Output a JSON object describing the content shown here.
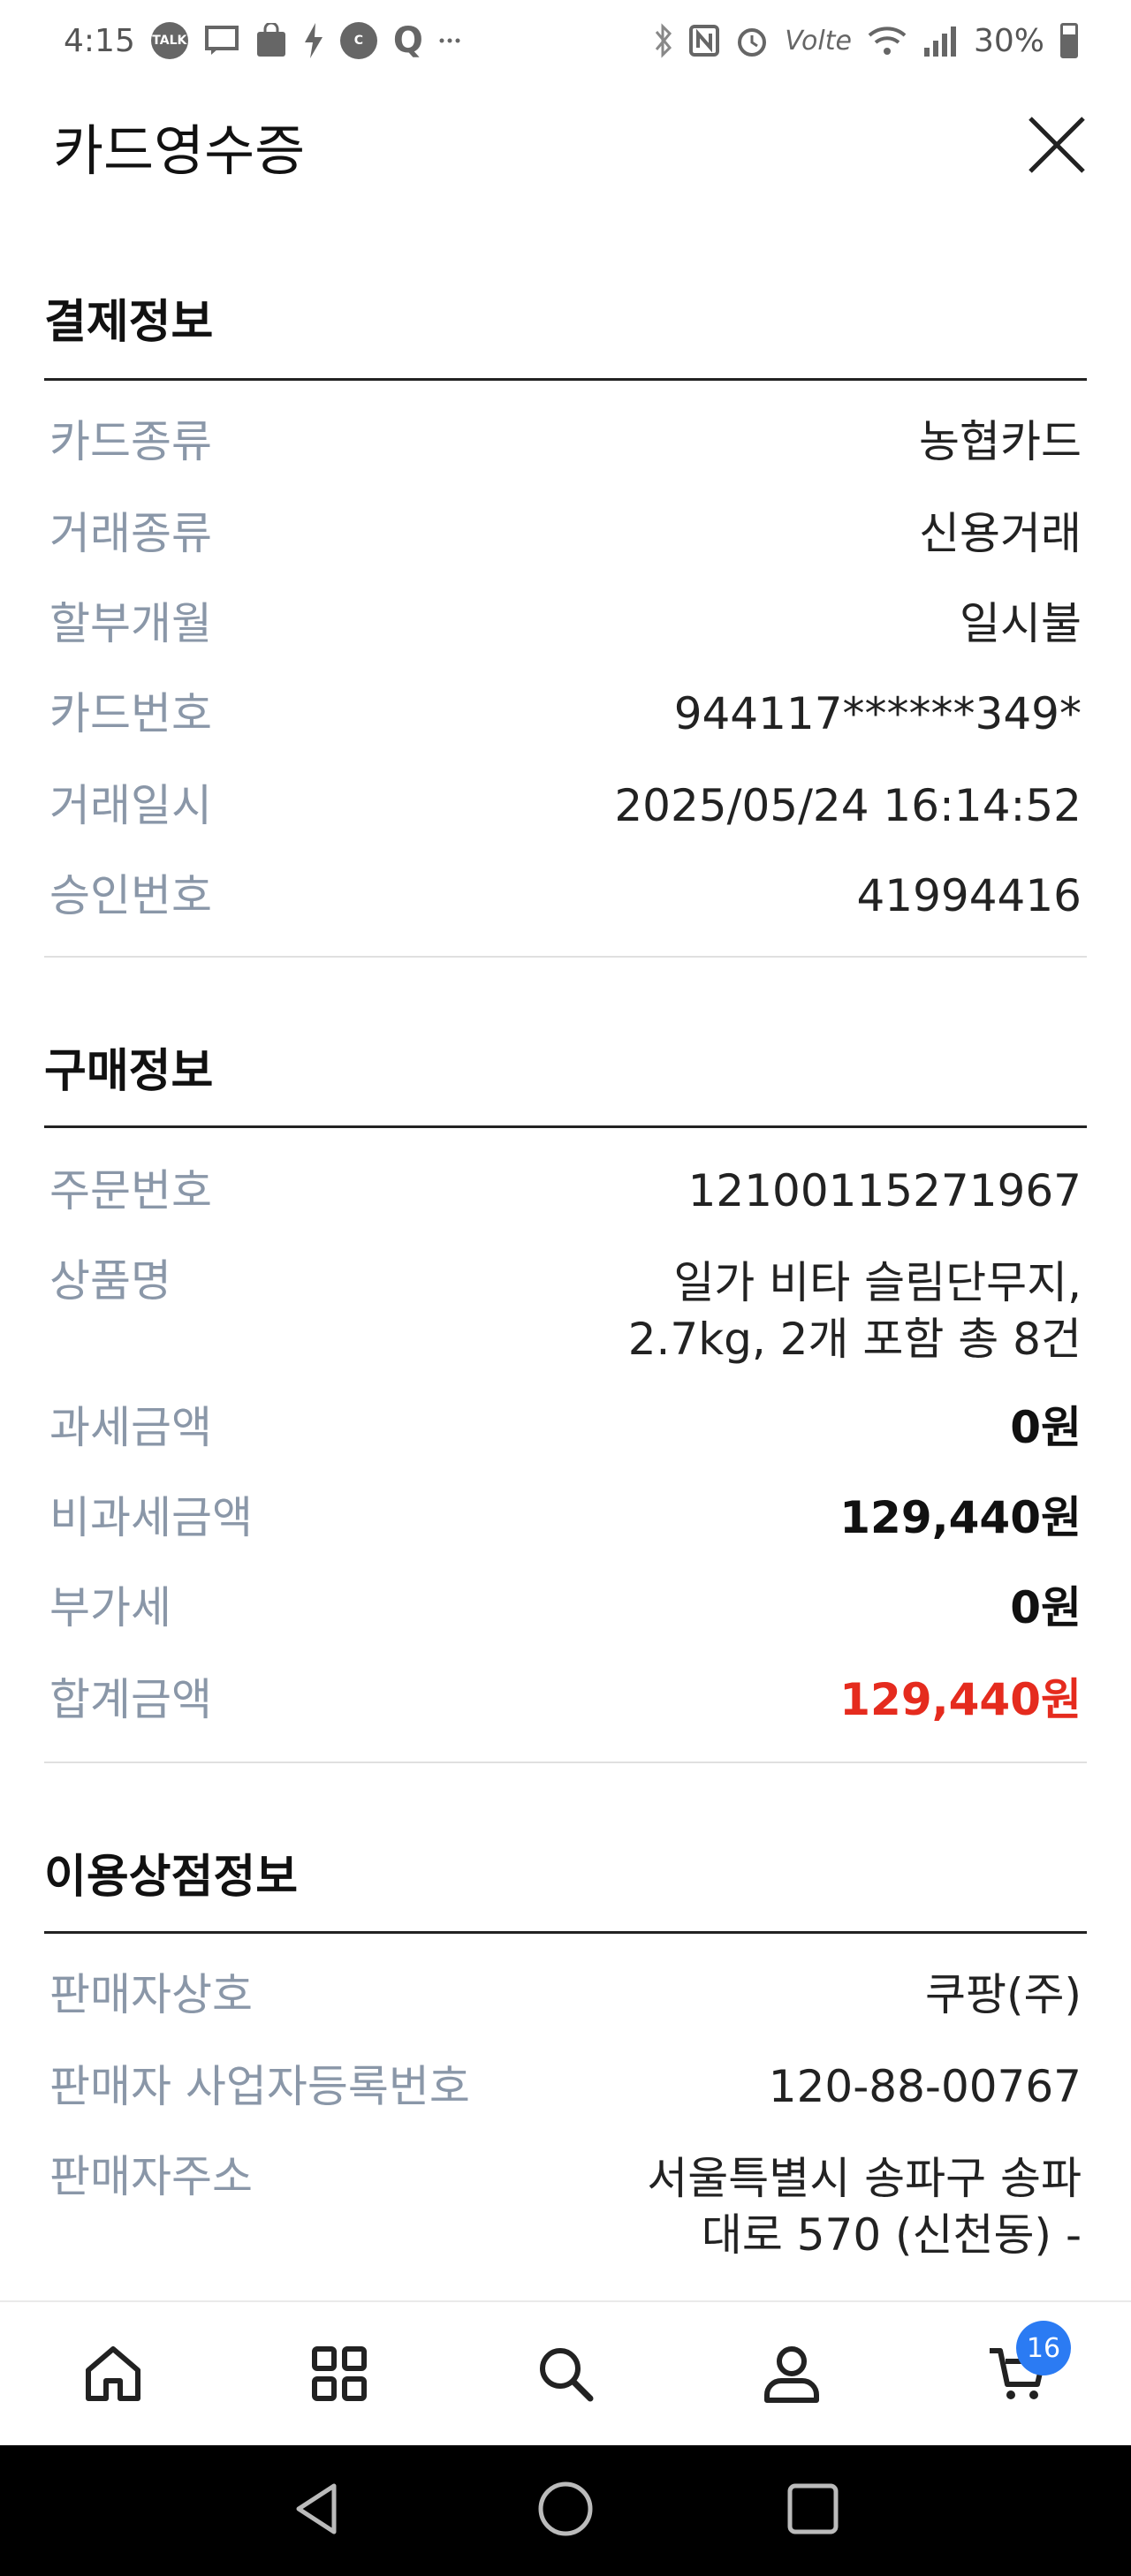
{
  "status_bar": {
    "time": "4:15",
    "talk_badge": "TALK",
    "network": "Volte",
    "battery": "30%"
  },
  "header": {
    "title": "카드영수증"
  },
  "payment_section": {
    "title": "결제정보",
    "rows": [
      {
        "label": "카드종류",
        "value": "농협카드"
      },
      {
        "label": "거래종류",
        "value": "신용거래"
      },
      {
        "label": "할부개월",
        "value": "일시불"
      },
      {
        "label": "카드번호",
        "value": "944117******349*"
      },
      {
        "label": "거래일시",
        "value": "2025/05/24 16:14:52"
      },
      {
        "label": "승인번호",
        "value": "41994416"
      }
    ]
  },
  "purchase_section": {
    "title": "구매정보",
    "order_no": {
      "label": "주문번호",
      "value": "12100115271967"
    },
    "product": {
      "label": "상품명",
      "value_line1": "일가 비타 슬림단무지,",
      "value_line2": "2.7kg, 2개 포함 총 8건"
    },
    "taxable": {
      "label": "과세금액",
      "value": "0원"
    },
    "non_taxable": {
      "label": "비과세금액",
      "value": "129,440원"
    },
    "vat": {
      "label": "부가세",
      "value": "0원"
    },
    "total": {
      "label": "합계금액",
      "value": "129,440원"
    }
  },
  "merchant_section": {
    "title": "이용상점정보",
    "seller_name": {
      "label": "판매자상호",
      "value": "쿠팡(주)"
    },
    "seller_reg_no": {
      "label": "판매자 사업자등록번호",
      "value": "120-88-00767"
    },
    "seller_address": {
      "label": "판매자주소",
      "value_line1": "서울특별시 송파구 송파",
      "value_line2": "대로 570 (신천동) -"
    }
  },
  "bottom_nav": {
    "items": [
      "home-icon",
      "categories-icon",
      "search-icon",
      "profile-icon",
      "cart-icon"
    ],
    "cart_count": "16"
  },
  "colors": {
    "label": "#8a97a8",
    "total_red": "#e52b1e",
    "badge_blue": "#2b7bf3"
  }
}
